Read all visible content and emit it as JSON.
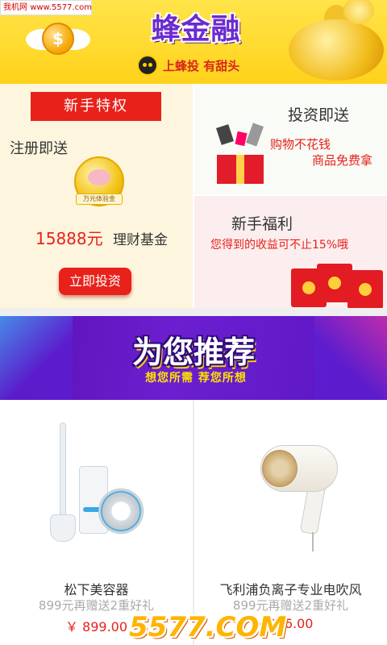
{
  "watermark": {
    "site": "我机网",
    "url": "www.5577.com",
    "bottom": "5577.COM"
  },
  "banner": {
    "brand": "蜂金融",
    "slogan": "上蜂投 有甜头"
  },
  "promo": {
    "privilege_label": "新手特权",
    "register_label": "注册即送",
    "trial_tag": "万元体验金",
    "fund_amount": "15888元",
    "fund_label": "理财基金",
    "invest_button": "立即投资",
    "invest_gift": {
      "title": "投资即送",
      "line1": "购物不花钱",
      "line2": "商品免费拿"
    },
    "newbie": {
      "title": "新手福利",
      "desc": "您得到的收益可不止15%哦"
    }
  },
  "recommend": {
    "title": "为您推荐",
    "subtitle": "想您所需 荐您所想"
  },
  "products": [
    {
      "name": "松下美容器",
      "promo": "899元再赠送2重好礼",
      "price": "￥ 899.00"
    },
    {
      "name": "飞利浦负离子专业电吹风",
      "promo": "899元再赠送2重好礼",
      "price": "286.00"
    }
  ],
  "colors": {
    "accent": "#e8211b",
    "banner_yellow": "#ffd21a",
    "recommend_purple": "#5a0fb0"
  }
}
